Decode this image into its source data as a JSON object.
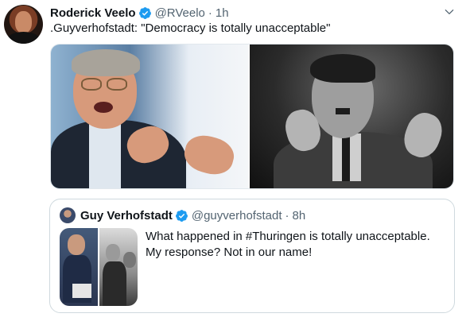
{
  "tweet": {
    "author_name": "Roderick Veelo",
    "handle": "@RVeelo",
    "separator": "·",
    "time": "1h",
    "text": ".Guyverhofstadt: \"Democracy is totally unacceptable\"",
    "icons": [
      "verified-badge-icon",
      "chevron-down-icon"
    ],
    "accent_color": "#1d9bf0"
  },
  "quoted_tweet": {
    "author_name": "Guy Verhofstadt",
    "handle": "@guyverhofstadt",
    "separator": "·",
    "time": "8h",
    "text_lines": [
      "What happened in #Thuringen is totally unacceptable.",
      "My response? Not in our name!"
    ]
  }
}
